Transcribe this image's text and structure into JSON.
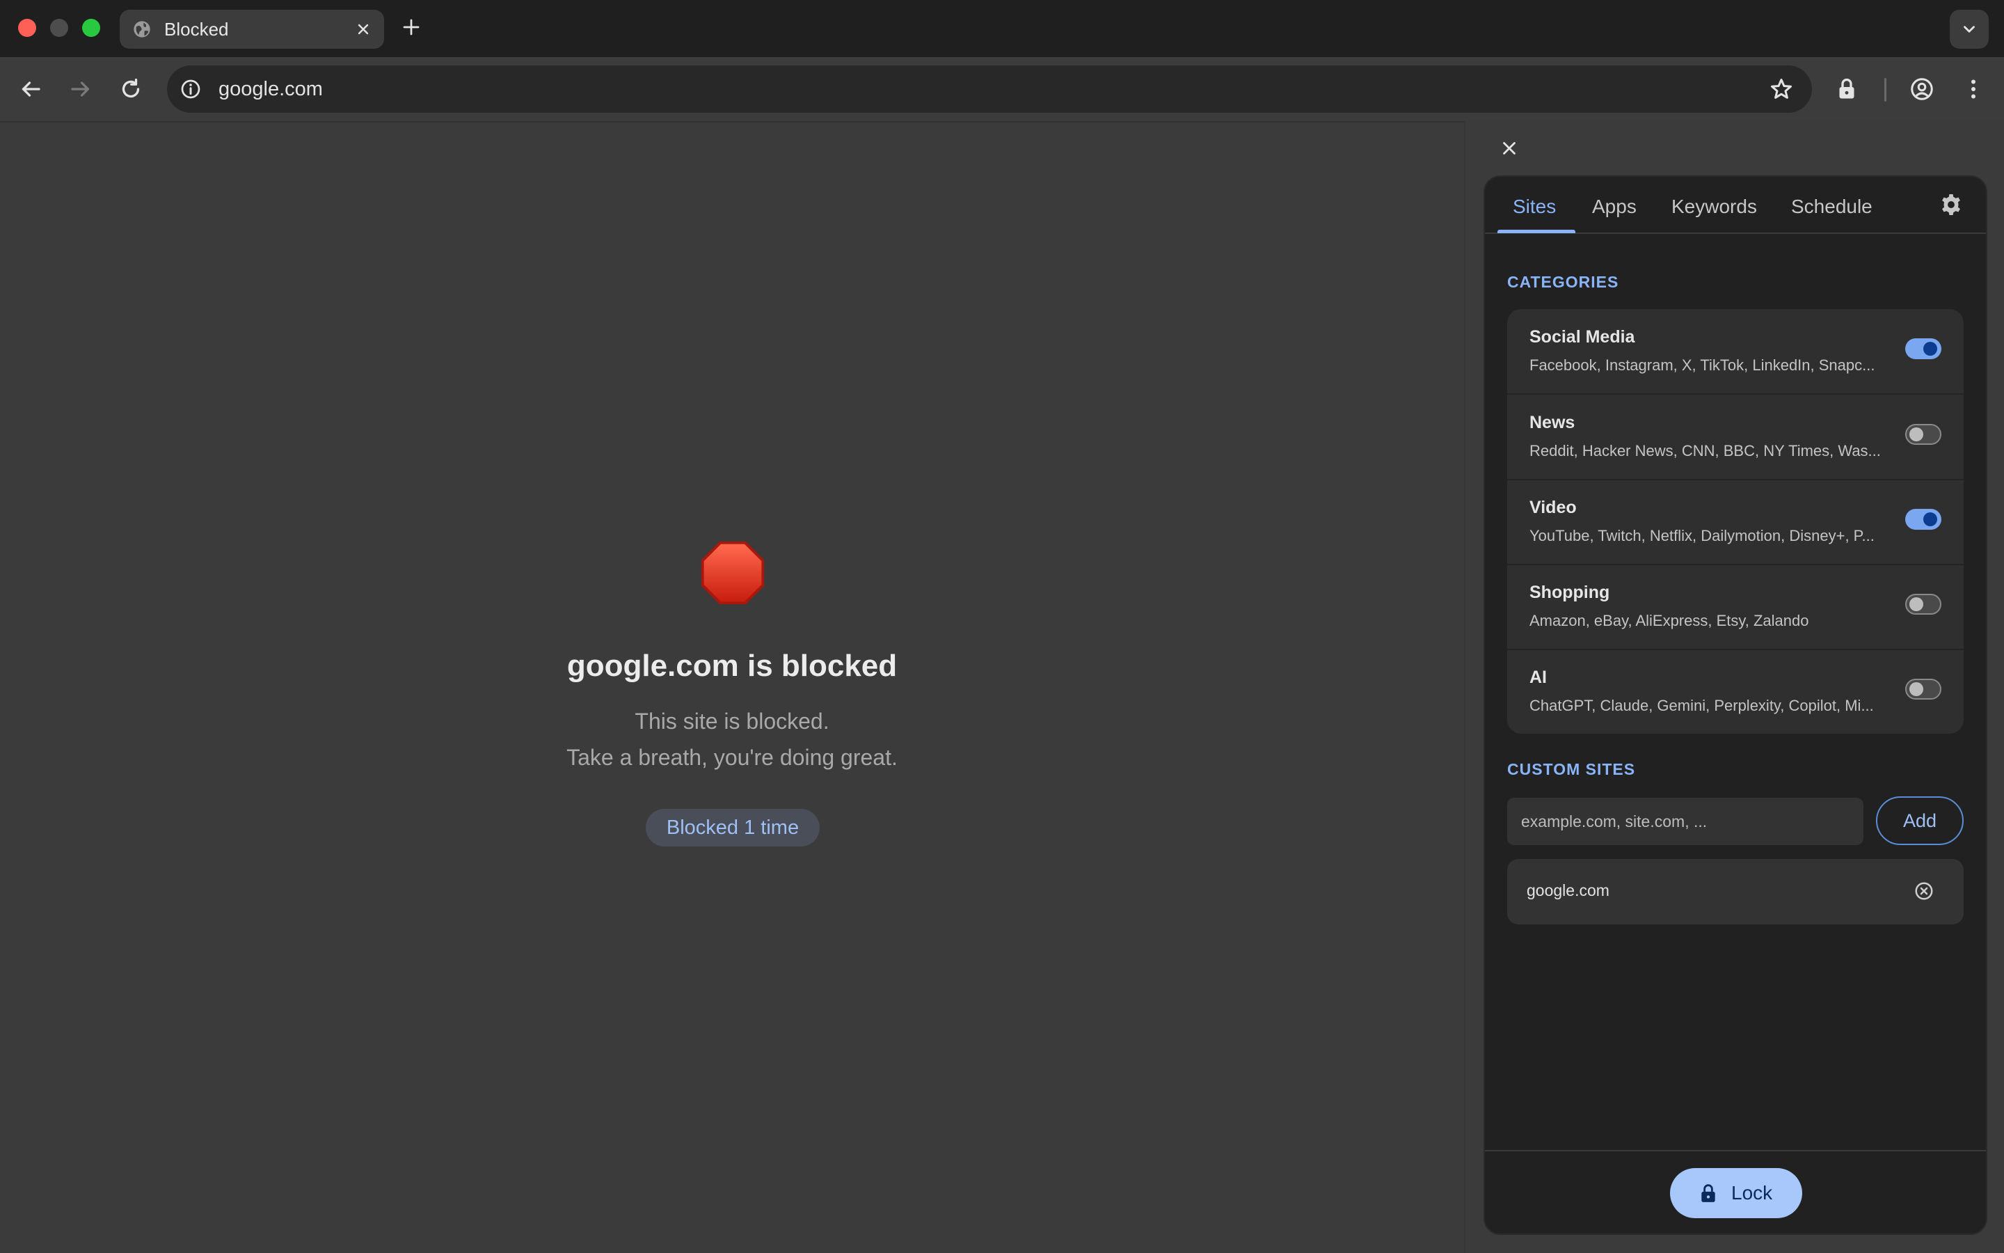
{
  "browser": {
    "tab_title": "Blocked",
    "url": "google.com"
  },
  "blocked_page": {
    "title": "google.com is blocked",
    "message_line1": "This site is blocked.",
    "message_line2": "Take a breath, you're doing great.",
    "badge": "Blocked 1 time"
  },
  "panel": {
    "tabs": [
      {
        "label": "Sites",
        "active": true
      },
      {
        "label": "Apps",
        "active": false
      },
      {
        "label": "Keywords",
        "active": false
      },
      {
        "label": "Schedule",
        "active": false
      }
    ],
    "categories_label": "CATEGORIES",
    "categories": [
      {
        "name": "Social Media",
        "sites": "Facebook, Instagram, X, TikTok, LinkedIn, Snapc...",
        "enabled": true
      },
      {
        "name": "News",
        "sites": "Reddit, Hacker News, CNN, BBC, NY Times, Was...",
        "enabled": false
      },
      {
        "name": "Video",
        "sites": "YouTube, Twitch, Netflix, Dailymotion, Disney+, P...",
        "enabled": true
      },
      {
        "name": "Shopping",
        "sites": "Amazon, eBay, AliExpress, Etsy, Zalando",
        "enabled": false
      },
      {
        "name": "AI",
        "sites": "ChatGPT, Claude, Gemini, Perplexity, Copilot, Mi...",
        "enabled": false
      }
    ],
    "custom_sites_label": "CUSTOM SITES",
    "custom_input_placeholder": "example.com, site.com, ...",
    "add_label": "Add",
    "custom_sites": [
      "google.com"
    ],
    "lock_label": "Lock"
  },
  "colors": {
    "accent": "#8ab4f8",
    "toggle_on": "#7aa7f0",
    "stop_red": "#e0301e"
  }
}
